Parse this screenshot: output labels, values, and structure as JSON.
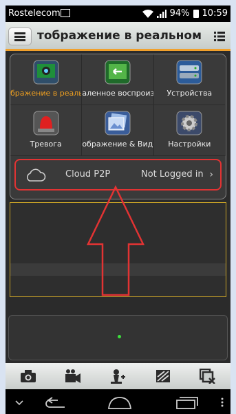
{
  "status_bar": {
    "carrier": "Rostelecom",
    "battery": "94%",
    "time": "10:59"
  },
  "title_bar": {
    "title": "тображение в реальном вр"
  },
  "menu_grid": [
    {
      "label": "бражение в реальн",
      "icon": "live-view-icon",
      "active": true
    },
    {
      "label": "аленное воспроиз",
      "icon": "playback-icon",
      "active": false
    },
    {
      "label": "Устройства",
      "icon": "devices-icon",
      "active": false
    },
    {
      "label": "Тревога",
      "icon": "alarm-icon",
      "active": false
    },
    {
      "label": "ображение & Виде",
      "icon": "image-video-icon",
      "active": false
    },
    {
      "label": "Настройки",
      "icon": "settings-icon",
      "active": false
    }
  ],
  "cloud": {
    "label": "Cloud P2P",
    "status": "Not Logged in",
    "chevron": "›"
  },
  "toolbar": {
    "icons": [
      "camera-icon",
      "record-icon",
      "ptz-icon",
      "image-quality-icon",
      "close-all-icon"
    ]
  },
  "colors": {
    "accent": "#f0a020",
    "highlight_red": "#e23333",
    "status_dot": "#3ce13c"
  }
}
